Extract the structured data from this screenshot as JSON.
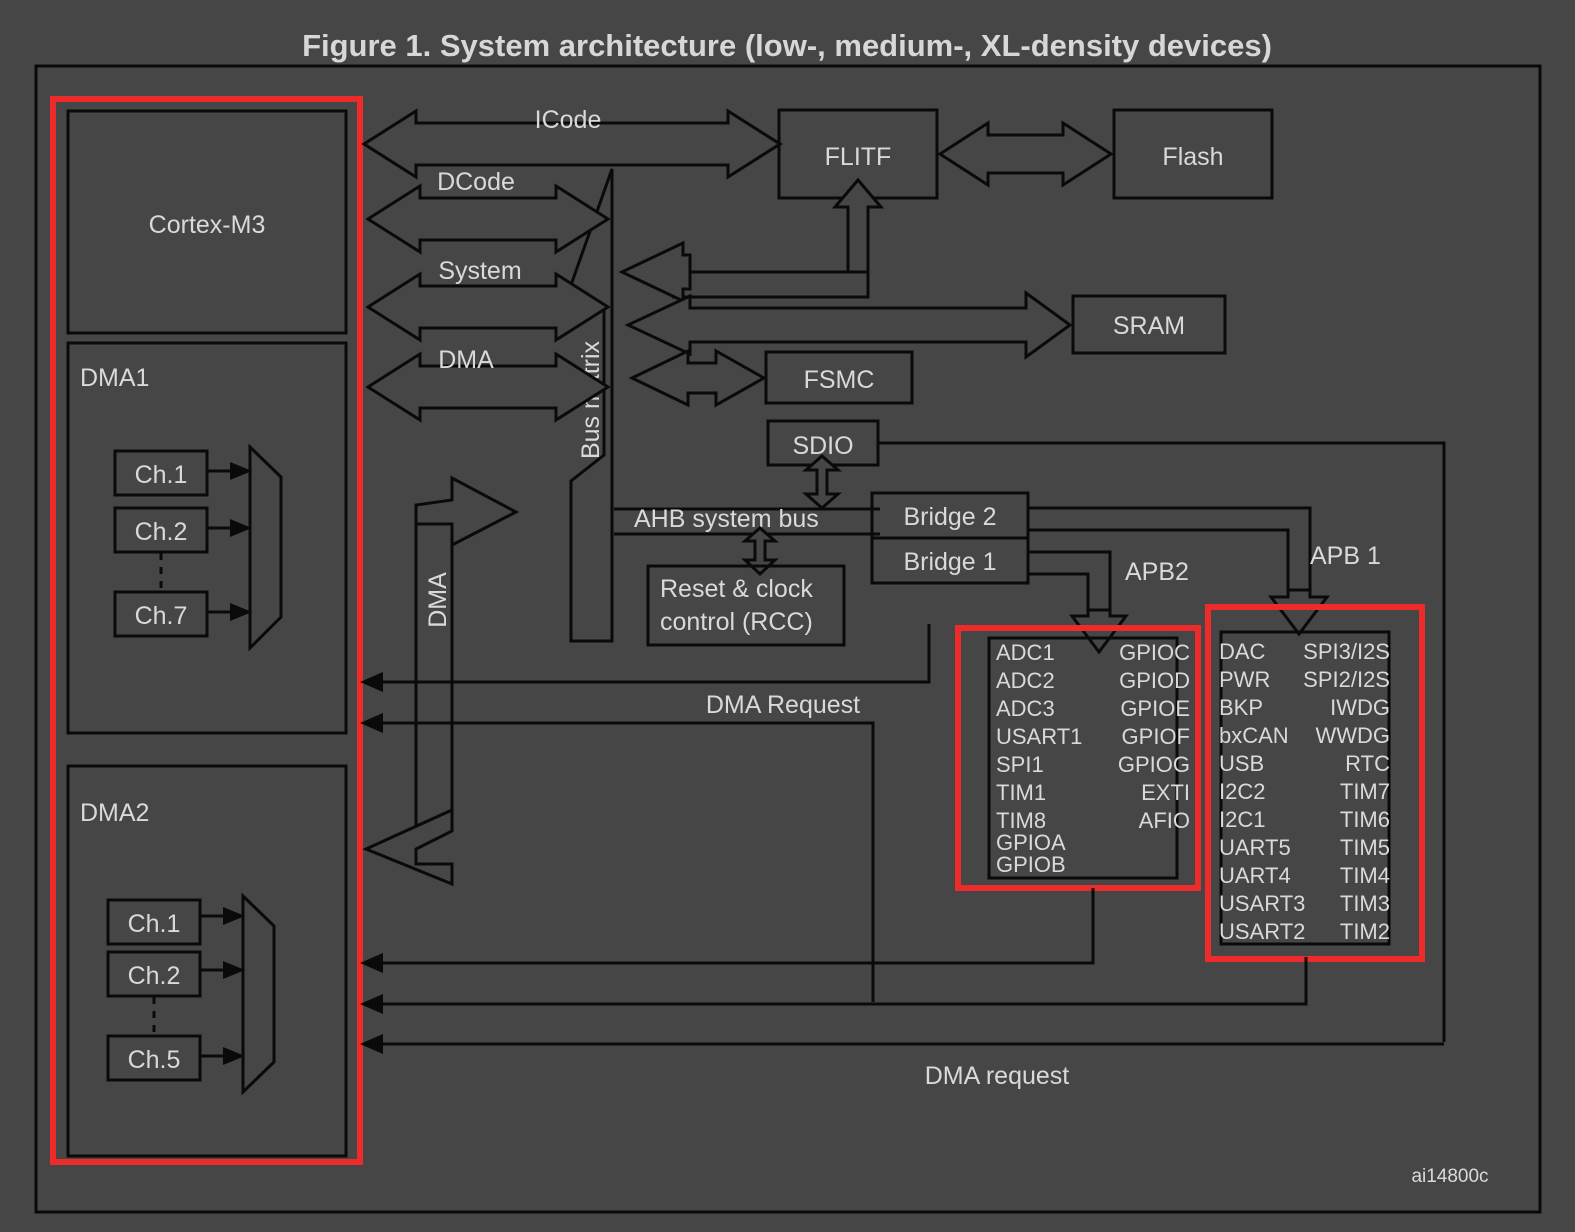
{
  "figure": {
    "title": "Figure 1. System architecture (low-, medium-, XL-density devices)",
    "watermark": "ai14800c"
  },
  "core": {
    "cpu_label": "Cortex-M3",
    "dma1_label": "DMA1",
    "dma2_label": "DMA2",
    "dma1_channels": [
      "Ch.1",
      "Ch.2",
      "Ch.7"
    ],
    "dma2_channels": [
      "Ch.1",
      "Ch.2",
      "Ch.5"
    ]
  },
  "buses": {
    "icode": "ICode",
    "dcode": "DCode",
    "system": "System",
    "dma": "DMA",
    "dma_vertical": "DMA",
    "bus_matrix": "Bus matrix",
    "ahb_system_bus": "AHB system bus",
    "dma_request_upper": "DMA Request",
    "dma_request_lower": "DMA request",
    "apb1": "APB 1",
    "apb2": "APB2"
  },
  "blocks": {
    "flitf": "FLITF",
    "flash": "Flash",
    "sram": "SRAM",
    "fsmc": "FSMC",
    "sdio": "SDIO",
    "rcc_line1": "Reset & clock",
    "rcc_line2": "control (RCC)",
    "bridge2": "Bridge  2",
    "bridge1": "Bridge  1"
  },
  "apb2_peripherals": {
    "left": [
      "ADC1",
      "ADC2",
      "ADC3",
      "USART1",
      "SPI1",
      "TIM1",
      "TIM8",
      "GPIOA",
      "GPIOB"
    ],
    "right": [
      "GPIOC",
      "GPIOD",
      "GPIOE",
      "GPIOF",
      "GPIOG",
      "EXTI",
      "AFIO"
    ]
  },
  "apb1_peripherals": {
    "left": [
      "DAC",
      "PWR",
      "BKP",
      "bxCAN",
      "USB",
      "I2C2",
      "I2C1",
      "UART5",
      "UART4",
      "USART3",
      "USART2"
    ],
    "right": [
      "SPI3/I2S",
      "SPI2/I2S",
      "IWDG",
      "WWDG",
      "RTC",
      "TIM7",
      "TIM6",
      "TIM5",
      "TIM4",
      "TIM3",
      "TIM2"
    ]
  },
  "colors": {
    "background": "#464646",
    "line": "#0a0a0a",
    "text": "#d9d9d9",
    "highlight": "#ee2b2b"
  }
}
